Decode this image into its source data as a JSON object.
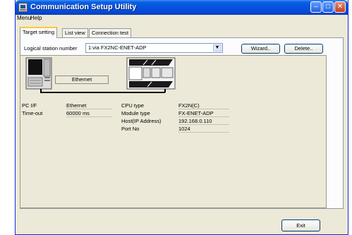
{
  "window": {
    "title": "Communication Setup Utility",
    "caption_buttons": {
      "minimize": "–",
      "maximize": "□",
      "close": "✕"
    }
  },
  "menu": [
    "Menu",
    "Help"
  ],
  "tabs": [
    {
      "label": "Target setting",
      "active": true
    },
    {
      "label": "List view",
      "active": false
    },
    {
      "label": "Connection test",
      "active": false
    }
  ],
  "station": {
    "label": "Logical station number",
    "value": "1:via FX2NC-ENET-ADP",
    "dropdown_arrow": "▼"
  },
  "buttons": {
    "wizard": "Wizard..",
    "delete": "Delete..",
    "exit": "Exit"
  },
  "diagram": {
    "connection_label": "Ethernet",
    "pc_icon": "pc-computer-icon",
    "plc_icon": "plc-device-icon"
  },
  "pc_info": [
    {
      "label": "PC I/F",
      "value": "Ethernet"
    },
    {
      "label": "Time-out",
      "value": "60000 ms"
    }
  ],
  "plc_info": [
    {
      "label": "CPU type",
      "value": "FX2N(C)"
    },
    {
      "label": "Module type",
      "value": "FX-ENET-ADP"
    },
    {
      "label": "Host(IP Address)",
      "value": "192.168.0.110"
    },
    {
      "label": "Port No",
      "value": "1024"
    }
  ],
  "colors": {
    "titlebar": "#0553e0",
    "face": "#ece9d8",
    "tab_highlight": "#ffc83c"
  }
}
